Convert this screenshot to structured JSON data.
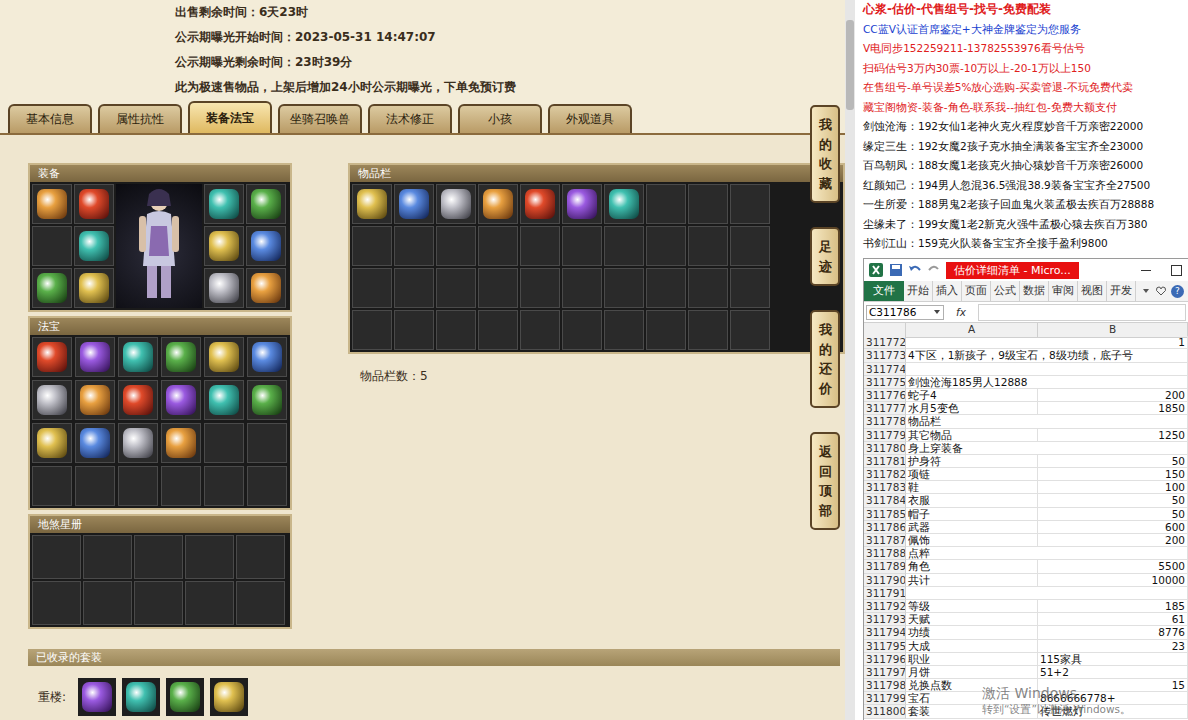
{
  "page": {
    "info_lines": [
      {
        "label": "出售剩余时间：",
        "value": "6天23时"
      },
      {
        "label": "公示期曝光开始时间：",
        "value": "2023-05-31 14:47:07"
      },
      {
        "label": "公示期曝光剩余时间：",
        "value": "23时39分"
      }
    ],
    "notice": "此为极速售物品，上架后增加24小时公示期曝光，下单免预订费",
    "tabs": [
      {
        "label": "基本信息",
        "selected": false
      },
      {
        "label": "属性抗性",
        "selected": false
      },
      {
        "label": "装备法宝",
        "selected": true
      },
      {
        "label": "坐骑召唤兽",
        "selected": false
      },
      {
        "label": "法术修正",
        "selected": false
      },
      {
        "label": "小孩",
        "selected": false
      },
      {
        "label": "外观道具",
        "selected": false
      }
    ],
    "equipment": {
      "title": "装备",
      "left_slots": [
        {
          "filled": true
        },
        {
          "filled": true
        },
        {
          "filled": false
        },
        {
          "filled": true
        },
        {
          "filled": true
        },
        {
          "filled": true
        }
      ],
      "right_slots": [
        {
          "filled": true
        },
        {
          "filled": true
        },
        {
          "filled": true
        },
        {
          "filled": true
        },
        {
          "filled": true
        },
        {
          "filled": true
        }
      ]
    },
    "fabao": {
      "title": "法宝",
      "slots": [
        {
          "filled": true
        },
        {
          "filled": true
        },
        {
          "filled": true
        },
        {
          "filled": true
        },
        {
          "filled": true
        },
        {
          "filled": true
        },
        {
          "filled": true
        },
        {
          "filled": true
        },
        {
          "filled": true
        },
        {
          "filled": true
        },
        {
          "filled": true
        },
        {
          "filled": true
        },
        {
          "filled": true
        },
        {
          "filled": true
        },
        {
          "filled": true
        },
        {
          "filled": true
        },
        {
          "filled": false
        },
        {
          "filled": false
        },
        {
          "filled": false
        },
        {
          "filled": false
        },
        {
          "filled": false
        },
        {
          "filled": false
        },
        {
          "filled": false
        },
        {
          "filled": false
        }
      ]
    },
    "dishaxing": {
      "title": "地煞星册",
      "slots": [
        {
          "filled": false
        },
        {
          "filled": false
        },
        {
          "filled": false
        },
        {
          "filled": false
        },
        {
          "filled": false
        },
        {
          "filled": false
        },
        {
          "filled": false
        },
        {
          "filled": false
        },
        {
          "filled": false
        },
        {
          "filled": false
        }
      ]
    },
    "inventory": {
      "title": "物品栏",
      "count_label": "物品栏数：5",
      "slots": [
        {
          "filled": true
        },
        {
          "filled": true
        },
        {
          "filled": true
        },
        {
          "filled": true
        },
        {
          "filled": true
        },
        {
          "filled": true
        },
        {
          "filled": true
        },
        {
          "filled": false
        },
        {
          "filled": false
        },
        {
          "filled": false
        },
        {
          "filled": false
        },
        {
          "filled": false
        },
        {
          "filled": false
        },
        {
          "filled": false
        },
        {
          "filled": false
        },
        {
          "filled": false
        },
        {
          "filled": false
        },
        {
          "filled": false
        },
        {
          "filled": false
        },
        {
          "filled": false
        },
        {
          "filled": false
        },
        {
          "filled": false
        },
        {
          "filled": false
        },
        {
          "filled": false
        },
        {
          "filled": false
        },
        {
          "filled": false
        },
        {
          "filled": false
        },
        {
          "filled": false
        },
        {
          "filled": false
        },
        {
          "filled": false
        },
        {
          "filled": false
        },
        {
          "filled": false
        },
        {
          "filled": false
        },
        {
          "filled": false
        },
        {
          "filled": false
        },
        {
          "filled": false
        },
        {
          "filled": false
        },
        {
          "filled": false
        },
        {
          "filled": false
        },
        {
          "filled": false
        }
      ]
    },
    "sets": {
      "title": "已收录的套装",
      "groups": [
        {
          "name": "重楼:",
          "items": [
            {
              "filled": true
            },
            {
              "filled": true
            },
            {
              "filled": true
            },
            {
              "filled": true
            }
          ]
        }
      ]
    },
    "side_buttons": [
      "我的收藏",
      "足迹",
      "我的还价",
      "返回顶部"
    ]
  },
  "ad_panel": {
    "lines": [
      {
        "text": "心浆-估价-代售组号-找号-免费配装",
        "color": "#e0201c"
      },
      {
        "text": "CC蓝V认证首席鉴定+大神金牌鉴定为您服务",
        "color": "#1a3fd0"
      },
      {
        "text": "V电同步152259211-13782553976看号估号",
        "color": "#e0201c"
      },
      {
        "text": "扫码估号3万内30票-10万以上-20-1万以上150",
        "color": "#e0201c"
      },
      {
        "text": "在售组号-单号误差5%放心选购-买卖管退-不玩免费代卖",
        "color": "#e0201c"
      },
      {
        "text": "藏宝阁物资-装备-角色-联系我--抽红包-免费大额支付",
        "color": "#e0201c"
      },
      {
        "text": "剑蚀沧海：192女仙1老神火克火程度妙音千万亲密22000",
        "color": "#111111"
      },
      {
        "text": "缘定三生：192女魔2孩子克水抽全满装备宝宝齐全23000",
        "color": "#111111"
      },
      {
        "text": "百鸟朝凤：188女魔1老孩克火抽心猿妙音千万亲密26000",
        "color": "#111111"
      },
      {
        "text": "红颜知己：194男人忽混36.5强混38.9装备宝宝齐全27500",
        "color": "#111111"
      },
      {
        "text": "一生所爱：188男鬼2老孩子回血鬼火装孟极去疾百万28888",
        "color": "#111111"
      },
      {
        "text": "尘缘未了：199女魔1老2新克火强牛孟极心猿去疾百万380",
        "color": "#111111"
      },
      {
        "text": "书剑江山：159克火队装备宝宝齐全接手盈利9800",
        "color": "#111111"
      }
    ]
  },
  "excel": {
    "title": "估价详细清单 - Micro...",
    "file_button": "文件",
    "ribbon_tabs": [
      "开始",
      "插入",
      "页面",
      "公式",
      "数据",
      "审阅",
      "视图",
      "开发"
    ],
    "help": "?",
    "name_box": "C311786",
    "fx": "fx",
    "columns": [
      "A",
      "B"
    ],
    "rows": [
      {
        "num": "311772",
        "a": "1",
        "b": ""
      },
      {
        "num": "311773",
        "a": "4下区，1新孩子，9级宝石，8级功绩，底子号",
        "b": ""
      },
      {
        "num": "311774",
        "a": "",
        "b": ""
      },
      {
        "num": "311775",
        "a": "剑蚀沧海185男人12888",
        "b": ""
      },
      {
        "num": "311776",
        "a": "蛇子4",
        "b": "200"
      },
      {
        "num": "311777",
        "a": "水月5变色",
        "b": "1850"
      },
      {
        "num": "311778",
        "a": "物品栏",
        "b": ""
      },
      {
        "num": "311779",
        "a": "其它物品",
        "b": "1250"
      },
      {
        "num": "311780",
        "a": "身上穿装备",
        "b": ""
      },
      {
        "num": "311781",
        "a": "护身符",
        "b": "50"
      },
      {
        "num": "311782",
        "a": "项链",
        "b": "150"
      },
      {
        "num": "311783",
        "a": "鞋",
        "b": "100"
      },
      {
        "num": "311784",
        "a": "衣服",
        "b": "50"
      },
      {
        "num": "311785",
        "a": "帽子",
        "b": "50"
      },
      {
        "num": "311786",
        "a": "武器",
        "b": "600"
      },
      {
        "num": "311787",
        "a": "佩饰",
        "b": "200"
      },
      {
        "num": "311788",
        "a": "点粹",
        "b": ""
      },
      {
        "num": "311789",
        "a": "角色",
        "b": "5500"
      },
      {
        "num": "311790",
        "a": "共计",
        "b": "10000"
      },
      {
        "num": "311791",
        "a": "",
        "b": ""
      },
      {
        "num": "311792",
        "a": "等级",
        "b": "185"
      },
      {
        "num": "311793",
        "a": "天赋",
        "b": "61"
      },
      {
        "num": "311794",
        "a": "功绩",
        "b": "8776"
      },
      {
        "num": "311795",
        "a": "大成",
        "b": "23"
      },
      {
        "num": "311796",
        "a": "职业",
        "b": "115家具"
      },
      {
        "num": "311797",
        "a": "月饼",
        "b": "51+2"
      },
      {
        "num": "311798",
        "a": "兑换点数",
        "b": "15"
      },
      {
        "num": "311799",
        "a": "宝石",
        "b": "8666666778+"
      },
      {
        "num": "311800",
        "a": "套装",
        "b": "传世燃灯"
      }
    ],
    "activation": {
      "title": "激活 Windows",
      "subtitle": "转到“设置”以激活 Windows。"
    }
  }
}
